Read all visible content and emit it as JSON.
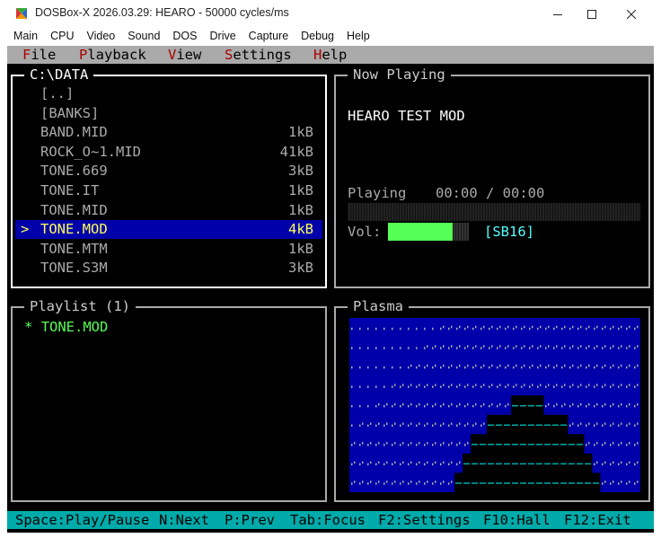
{
  "window": {
    "title": "DOSBox-X 2026.03.29: HEARO - 50000 cycles/ms",
    "icon": "dosbox-x-icon"
  },
  "host_menu": [
    "Main",
    "CPU",
    "Video",
    "Sound",
    "DOS",
    "Drive",
    "Capture",
    "Debug",
    "Help"
  ],
  "app_menu": [
    {
      "hot": "F",
      "rest": "ile"
    },
    {
      "hot": "P",
      "rest": "layback"
    },
    {
      "hot": "V",
      "rest": "iew"
    },
    {
      "hot": "S",
      "rest": "ettings"
    },
    {
      "hot": "H",
      "rest": "elp"
    }
  ],
  "browser": {
    "title": "C:\\DATA",
    "cursor": ">",
    "items": [
      {
        "name": "[..]",
        "size": ""
      },
      {
        "name": "[BANKS]",
        "size": ""
      },
      {
        "name": "BAND.MID",
        "size": "1kB"
      },
      {
        "name": "ROCK_O~1.MID",
        "size": "41kB"
      },
      {
        "name": "TONE.669",
        "size": "3kB"
      },
      {
        "name": "TONE.IT",
        "size": "1kB"
      },
      {
        "name": "TONE.MID",
        "size": "1kB"
      },
      {
        "name": "TONE.MOD",
        "size": "4kB",
        "selected": true
      },
      {
        "name": "TONE.MTM",
        "size": "1kB"
      },
      {
        "name": "TONE.S3M",
        "size": "3kB"
      }
    ]
  },
  "now_playing": {
    "title": "Now Playing",
    "song": "HEARO TEST MOD",
    "status": "Playing",
    "time": "00:00 / 00:00",
    "progress": 0.0,
    "vol_label": "Vol:",
    "volume": 0.8,
    "device": "[SB16]"
  },
  "playlist": {
    "title": "Playlist (1)",
    "items": [
      {
        "marker": "*",
        "name": "TONE.MOD"
      }
    ]
  },
  "plasma": {
    "title": "Plasma",
    "colors": {
      "bg": "#0000aa",
      "dot": "#aaaaaa",
      "cyan": "#00aaaa",
      "black": "#000000"
    }
  },
  "statusbar": [
    "Space:Play/Pause",
    "N:Next",
    "P:Prev",
    "Tab:Focus",
    "F2:Settings",
    "F10:Hall",
    "F12:Exit"
  ]
}
